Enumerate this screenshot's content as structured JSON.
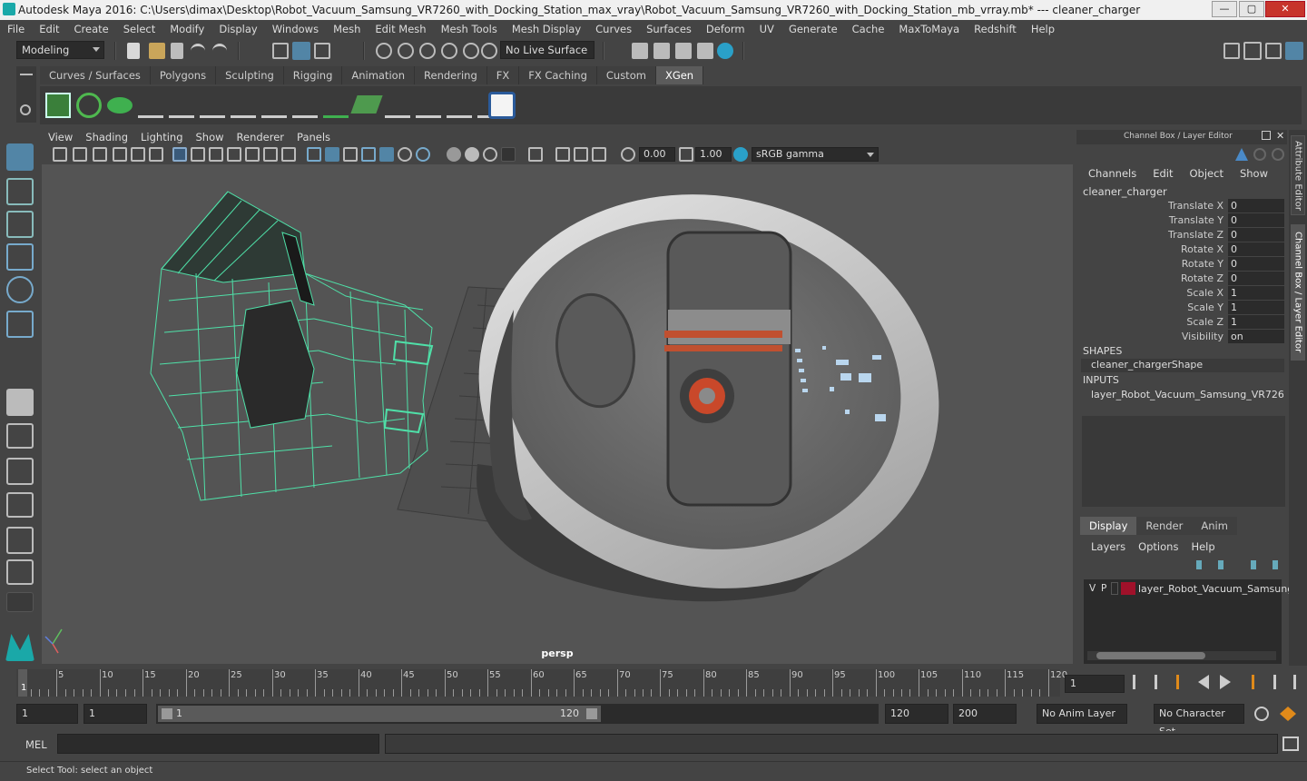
{
  "window": {
    "title": "Autodesk Maya 2016: C:\\Users\\dimax\\Desktop\\Robot_Vacuum_Samsung_VR7260_with_Docking_Station_max_vray\\Robot_Vacuum_Samsung_VR7260_with_Docking_Station_mb_vrray.mb*   ---   cleaner_charger",
    "minimize": "—",
    "maximize": "▢",
    "close": "✕"
  },
  "menus": [
    "File",
    "Edit",
    "Create",
    "Select",
    "Modify",
    "Display",
    "Windows",
    "Mesh",
    "Edit Mesh",
    "Mesh Tools",
    "Mesh Display",
    "Curves",
    "Surfaces",
    "Deform",
    "UV",
    "Generate",
    "Cache",
    "MaxToMaya",
    "Redshift",
    "Help"
  ],
  "statusline": {
    "mode": "Modeling",
    "live_surface": "No Live Surface"
  },
  "shelf": {
    "tabs": [
      "Curves / Surfaces",
      "Polygons",
      "Sculpting",
      "Rigging",
      "Animation",
      "Rendering",
      "FX",
      "FX Caching",
      "Custom",
      "XGen"
    ],
    "active_tab": "XGen"
  },
  "viewport": {
    "menus": [
      "View",
      "Shading",
      "Lighting",
      "Show",
      "Renderer",
      "Panels"
    ],
    "exposure": "0.00",
    "gamma": "1.00",
    "color_space": "sRGB gamma",
    "camera_label": "persp"
  },
  "channel_box": {
    "header": "Channel Box / Layer Editor",
    "menus": [
      "Channels",
      "Edit",
      "Object",
      "Show"
    ],
    "object_name": "cleaner_charger",
    "attributes": [
      {
        "label": "Translate X",
        "value": "0"
      },
      {
        "label": "Translate Y",
        "value": "0"
      },
      {
        "label": "Translate Z",
        "value": "0"
      },
      {
        "label": "Rotate X",
        "value": "0"
      },
      {
        "label": "Rotate Y",
        "value": "0"
      },
      {
        "label": "Rotate Z",
        "value": "0"
      },
      {
        "label": "Scale X",
        "value": "1"
      },
      {
        "label": "Scale Y",
        "value": "1"
      },
      {
        "label": "Scale Z",
        "value": "1"
      },
      {
        "label": "Visibility",
        "value": "on"
      }
    ],
    "shapes_header": "SHAPES",
    "shape_name": "cleaner_chargerShape",
    "inputs_header": "INPUTS",
    "input_name": "layer_Robot_Vacuum_Samsung_VR726..."
  },
  "layer_editor": {
    "tabs": [
      "Display",
      "Render",
      "Anim"
    ],
    "active_tab": "Display",
    "menus": [
      "Layers",
      "Options",
      "Help"
    ],
    "layer": {
      "v": "V",
      "p": "P",
      "name": "layer_Robot_Vacuum_Samsung",
      "color": "#a0112a"
    }
  },
  "side_tabs": [
    "Attribute Editor",
    "Channel Box / Layer Editor"
  ],
  "timeline": {
    "ticks": [
      "5",
      "10",
      "15",
      "20",
      "25",
      "30",
      "35",
      "40",
      "45",
      "50",
      "55",
      "60",
      "65",
      "70",
      "75",
      "80",
      "85",
      "90",
      "95",
      "100",
      "105",
      "110",
      "115",
      "120"
    ],
    "start_marker": "1",
    "current_frame": "1"
  },
  "range": {
    "start": "1",
    "playback_start": "1",
    "slider_start": "1",
    "slider_end": "120",
    "playback_end": "120",
    "end": "200",
    "anim_layer": "No Anim Layer",
    "character_set": "No Character Set"
  },
  "command_line": {
    "label": "MEL"
  },
  "help_line": "Select Tool: select an object",
  "colors": {
    "accent_wire": "#4fe0a8",
    "active_blue": "#5285a6",
    "close_red": "#c7342b"
  }
}
